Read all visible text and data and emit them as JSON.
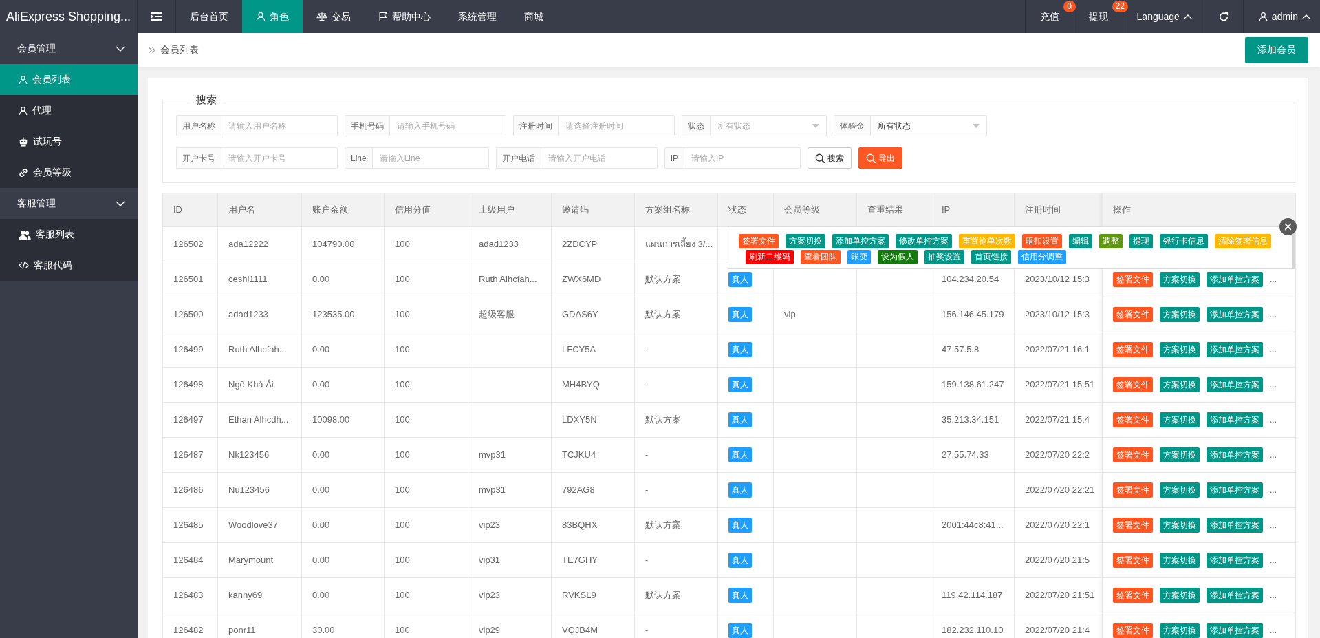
{
  "header": {
    "logo": "AliExpress Shopping...",
    "nav": [
      {
        "label": "后台首页",
        "selected": false
      },
      {
        "label": "角色",
        "selected": true
      },
      {
        "label": "交易",
        "selected": false
      },
      {
        "label": "帮助中心",
        "selected": false
      },
      {
        "label": "系统管理",
        "selected": false
      },
      {
        "label": "商城",
        "selected": false
      }
    ],
    "right": [
      {
        "kind": "badge",
        "label": "充值",
        "badge": "0"
      },
      {
        "kind": "badge",
        "label": "提现",
        "badge": "22"
      },
      {
        "kind": "dropdown",
        "label": "Language"
      },
      {
        "kind": "refresh"
      },
      {
        "kind": "user",
        "label": "admin"
      }
    ]
  },
  "sidebar": {
    "groups": [
      {
        "label": "会员管理",
        "expanded": true,
        "items": [
          {
            "label": "会员列表",
            "selected": true
          },
          {
            "label": "代理",
            "selected": false
          },
          {
            "label": "试玩号",
            "selected": false
          },
          {
            "label": "会员等级",
            "selected": false
          }
        ]
      },
      {
        "label": "客服管理",
        "expanded": true,
        "items": [
          {
            "label": "客服列表",
            "selected": false
          },
          {
            "label": "客服代码",
            "selected": false
          }
        ]
      }
    ]
  },
  "breadcrumb": {
    "current": "会员列表"
  },
  "add_button": "添加会员",
  "search": {
    "legend": "搜索",
    "rows": [
      {
        "fields": [
          {
            "kind": "text",
            "label": "用户名称",
            "placeholder": "请输入用户名称"
          },
          {
            "kind": "text",
            "label": "手机号码",
            "placeholder": "请输入手机号码"
          },
          {
            "kind": "text",
            "label": "注册时间",
            "placeholder": "请选择注册时间"
          },
          {
            "kind": "select",
            "label": "状态",
            "placeholder": "所有状态"
          },
          {
            "kind": "select",
            "label": "体验金",
            "value": "所有状态"
          }
        ]
      },
      {
        "fields": [
          {
            "kind": "text",
            "label": "开户卡号",
            "placeholder": "请输入开户卡号"
          },
          {
            "kind": "text",
            "label": "Line",
            "placeholder": "请输入Line"
          },
          {
            "kind": "text",
            "label": "开户电话",
            "placeholder": "请输入开户电话"
          },
          {
            "kind": "text",
            "label": "IP",
            "placeholder": "请输入IP"
          }
        ],
        "buttons": [
          {
            "kind": "default",
            "label": "搜索"
          },
          {
            "kind": "danger",
            "label": "导出"
          }
        ]
      }
    ]
  },
  "table": {
    "columns": [
      "ID",
      "用户名",
      "账户余额",
      "信用分值",
      "上级用户",
      "邀请码",
      "方案组名称",
      "状态",
      "会员等级",
      "查重结果",
      "IP",
      "注册时间",
      "操作"
    ],
    "rows": [
      {
        "id": "126502",
        "username": "ada12222",
        "balance": "104790.00",
        "credit": "100",
        "parent": "adad1233",
        "invite_code": "2ZDCYP",
        "scheme": "แผนการเลี้ยง 3/..."
      },
      {
        "id": "126501",
        "username": "ceshi1111",
        "balance": "0.00",
        "credit": "100",
        "parent": "Ruth Alhcfah...",
        "invite_code": "ZWX6MD",
        "scheme": "默认方案",
        "status": "真人",
        "ip": "104.234.20.54",
        "registered": "2023/10/12 15:3",
        "actions": [
          {
            "label": "签署文件",
            "color": "#ff5722"
          },
          {
            "label": "方案切换",
            "color": "#009688"
          },
          {
            "label": "添加单控方案",
            "color": "#009688"
          }
        ],
        "more": "..."
      },
      {
        "id": "126500",
        "username": "adad1233",
        "balance": "123535.00",
        "credit": "100",
        "parent": "超级客服",
        "invite_code": "GDAS6Y",
        "scheme": "默认方案",
        "status": "真人",
        "level": "vip",
        "ip": "156.146.45.179",
        "registered": "2023/10/12 15:3",
        "actions": [
          {
            "label": "签署文件",
            "color": "#ff5722"
          },
          {
            "label": "方案切换",
            "color": "#009688"
          },
          {
            "label": "添加单控方案",
            "color": "#009688"
          }
        ],
        "more": "..."
      },
      {
        "id": "126499",
        "username": "Ruth Alhcfah...",
        "balance": "0.00",
        "credit": "100",
        "invite_code": "LFCY5A",
        "scheme": "-",
        "status": "真人",
        "ip": "47.57.5.8",
        "registered": "2022/07/21 16:1",
        "actions": [
          {
            "label": "签署文件",
            "color": "#ff5722"
          },
          {
            "label": "方案切换",
            "color": "#009688"
          },
          {
            "label": "添加单控方案",
            "color": "#009688"
          }
        ],
        "more": "..."
      },
      {
        "id": "126498",
        "username": "Ngô Khả Ái",
        "balance": "0.00",
        "credit": "100",
        "invite_code": "MH4BYQ",
        "scheme": "-",
        "status": "真人",
        "ip": "159.138.61.247",
        "registered": "2022/07/21 15:51",
        "actions": [
          {
            "label": "签署文件",
            "color": "#ff5722"
          },
          {
            "label": "方案切换",
            "color": "#009688"
          },
          {
            "label": "添加单控方案",
            "color": "#009688"
          }
        ],
        "more": "..."
      },
      {
        "id": "126497",
        "username": "Ethan Alhcdh...",
        "balance": "10098.00",
        "credit": "100",
        "invite_code": "LDXY5N",
        "scheme": "默认方案",
        "status": "真人",
        "ip": "35.213.34.151",
        "registered": "2022/07/21 15:4",
        "actions": [
          {
            "label": "签署文件",
            "color": "#ff5722"
          },
          {
            "label": "方案切换",
            "color": "#009688"
          },
          {
            "label": "添加单控方案",
            "color": "#009688"
          }
        ],
        "more": "..."
      },
      {
        "id": "126487",
        "username": "Nk123456",
        "balance": "0.00",
        "credit": "100",
        "parent": "mvp31",
        "invite_code": "TCJKU4",
        "scheme": "-",
        "status": "真人",
        "ip": "27.55.74.33",
        "registered": "2022/07/20 22:2",
        "actions": [
          {
            "label": "签署文件",
            "color": "#ff5722"
          },
          {
            "label": "方案切换",
            "color": "#009688"
          },
          {
            "label": "添加单控方案",
            "color": "#009688"
          }
        ],
        "more": "..."
      },
      {
        "id": "126486",
        "username": "Nu123456",
        "balance": "0.00",
        "credit": "100",
        "parent": "mvp31",
        "invite_code": "792AG8",
        "scheme": "-",
        "status": "真人",
        "registered": "2022/07/20 22:21",
        "actions": [
          {
            "label": "签署文件",
            "color": "#ff5722"
          },
          {
            "label": "方案切换",
            "color": "#009688"
          },
          {
            "label": "添加单控方案",
            "color": "#009688"
          }
        ],
        "more": "..."
      },
      {
        "id": "126485",
        "username": "Woodlove37",
        "balance": "0.00",
        "credit": "100",
        "parent": "vip23",
        "invite_code": "83BQHX",
        "scheme": "默认方案",
        "status": "真人",
        "ip": "2001:44c8:41...",
        "registered": "2022/07/20 22:1",
        "actions": [
          {
            "label": "签署文件",
            "color": "#ff5722"
          },
          {
            "label": "方案切换",
            "color": "#009688"
          },
          {
            "label": "添加单控方案",
            "color": "#009688"
          }
        ],
        "more": "..."
      },
      {
        "id": "126484",
        "username": "Marymount",
        "balance": "0.00",
        "credit": "100",
        "parent": "vip31",
        "invite_code": "TE7GHY",
        "scheme": "-",
        "status": "真人",
        "registered": "2022/07/20 21:5",
        "actions": [
          {
            "label": "签署文件",
            "color": "#ff5722"
          },
          {
            "label": "方案切换",
            "color": "#009688"
          },
          {
            "label": "添加单控方案",
            "color": "#009688"
          }
        ],
        "more": "..."
      },
      {
        "id": "126483",
        "username": "kanny69",
        "balance": "0.00",
        "credit": "100",
        "parent": "vip23",
        "invite_code": "RVKSL9",
        "scheme": "默认方案",
        "status": "真人",
        "ip": "119.42.114.187",
        "registered": "2022/07/20 21:51",
        "actions": [
          {
            "label": "签署文件",
            "color": "#ff5722"
          },
          {
            "label": "方案切换",
            "color": "#009688"
          },
          {
            "label": "添加单控方案",
            "color": "#009688"
          }
        ],
        "more": "..."
      },
      {
        "id": "126482",
        "username": "ponr11",
        "balance": "30.00",
        "credit": "100",
        "parent": "vip29",
        "invite_code": "VQJB4M",
        "scheme": "-",
        "status": "真人",
        "ip": "182.232.110.10",
        "registered": "2022/07/20 21:4",
        "actions": [
          {
            "label": "签署文件",
            "color": "#ff5722"
          },
          {
            "label": "方案切换",
            "color": "#009688"
          },
          {
            "label": "添加单控方案",
            "color": "#009688"
          }
        ],
        "more": "..."
      }
    ]
  },
  "action_popup": {
    "buttons": [
      {
        "label": "签署文件",
        "color": "#ff5722"
      },
      {
        "label": "方案切换",
        "color": "#009688"
      },
      {
        "label": "添加单控方案",
        "color": "#009688"
      },
      {
        "label": "修改单控方案",
        "color": "#009688"
      },
      {
        "label": "重置抢单次数",
        "color": "#ffb800"
      },
      {
        "label": "暗扣设置",
        "color": "#ff5722"
      },
      {
        "label": "编辑",
        "color": "#009688"
      },
      {
        "label": "调整",
        "color": "#5f9710"
      },
      {
        "label": "提现",
        "color": "#009688"
      },
      {
        "label": "银行卡信息",
        "color": "#009688"
      },
      {
        "label": "清除签署信息",
        "color": "#ffb800"
      },
      {
        "label": "刷新二维码",
        "color": "#ff0000"
      },
      {
        "label": "查看团队",
        "color": "#ff5722"
      },
      {
        "label": "账变",
        "color": "#1e9fff"
      },
      {
        "label": "设为假人",
        "color": "#117a0b"
      },
      {
        "label": "抽奖设置",
        "color": "#009688"
      },
      {
        "label": "首页链接",
        "color": "#009688"
      },
      {
        "label": "信用分调整",
        "color": "#1e9fff"
      }
    ]
  }
}
